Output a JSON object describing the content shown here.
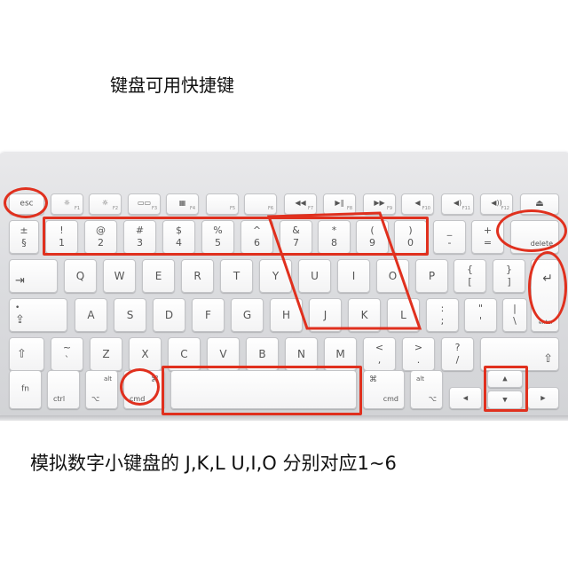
{
  "texts": {
    "heading": "键盘可用快捷键",
    "caption": "模拟数字小键盘的 J,K,L  U,I,O 分别对应1~6"
  },
  "colors": {
    "annotation": "#e0301e",
    "key_face": "#ffffff",
    "key_text": "#555555",
    "board": "#dcdde0"
  },
  "keys": {
    "esc": "esc",
    "f1": "F1",
    "f2": "F2",
    "f3": "F3",
    "f4": "F4",
    "f5": "F5",
    "f6": "F6",
    "f7": "F7",
    "f8": "F8",
    "f9": "F9",
    "f10": "F10",
    "f11": "F11",
    "f12": "F12",
    "f1_icon": "☼",
    "f2_icon": "☼",
    "f3_icon": "▭▭",
    "f4_icon": "▦",
    "f7_icon": "◀◀",
    "f8_icon": "▶‖",
    "f9_icon": "▶▶",
    "f10_icon": "◀",
    "f11_icon": "◀)",
    "f12_icon": "◀))",
    "eject_icon": "⏏",
    "sect_top": "±",
    "sect_bottom": "§",
    "n1_top": "!",
    "n1": "1",
    "n2_top": "@",
    "n2": "2",
    "n3_top": "#",
    "n3": "3",
    "n4_top": "$",
    "n4": "4",
    "n5_top": "%",
    "n5": "5",
    "n6_top": "^",
    "n6": "6",
    "n7_top": "&",
    "n7": "7",
    "n8_top": "*",
    "n8": "8",
    "n9_top": "(",
    "n9": "9",
    "n0_top": ")",
    "n0": "0",
    "minus_top": "_",
    "minus": "-",
    "equal_top": "+",
    "equal": "=",
    "delete": "delete",
    "tab": "⇥",
    "q": "Q",
    "w": "W",
    "e": "E",
    "r": "R",
    "t": "T",
    "y": "Y",
    "u": "U",
    "i": "I",
    "o": "O",
    "p": "P",
    "lbracket_top": "{",
    "lbracket": "[",
    "rbracket_top": "}",
    "rbracket": "]",
    "return": "↵",
    "enter": "enter",
    "caps_dot": "•",
    "caps": "⇪",
    "a": "A",
    "s": "S",
    "d": "D",
    "f": "F",
    "g": "G",
    "h": "H",
    "j": "J",
    "k": "K",
    "l": "L",
    "semicolon_top": ":",
    "semicolon": ";",
    "quote_top": "\"",
    "quote": "'",
    "backslash_top": "|",
    "backslash": "\\",
    "shift_left": "⇧",
    "shift_right": "⇧",
    "grave_top": "~",
    "grave": "`",
    "z": "Z",
    "x": "X",
    "c": "C",
    "v": "V",
    "b": "B",
    "n": "N",
    "m": "M",
    "comma_top": "<",
    "comma": ",",
    "period_top": ">",
    "period": ".",
    "slash_top": "?",
    "slash": "/",
    "fn": "fn",
    "ctrl": "ctrl",
    "opt_left": "⌥",
    "opt_left_label": "alt",
    "cmd_left": "cmd",
    "cmd_left_icon": "⌘",
    "cmd_right_icon": "⌘",
    "cmd_right": "cmd",
    "opt_right_label": "alt",
    "opt_right": "⌥",
    "arrow_left": "◀",
    "arrow_up": "▲",
    "arrow_down": "▼",
    "arrow_right": "▶"
  }
}
